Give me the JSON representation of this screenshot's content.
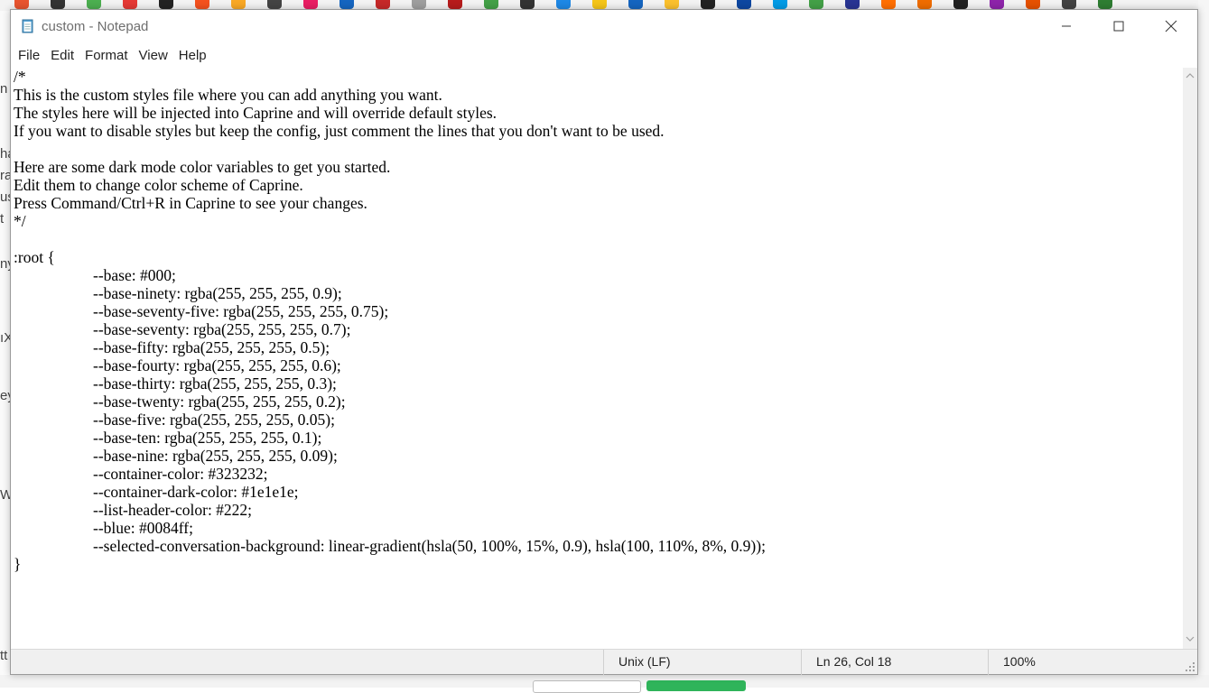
{
  "window": {
    "title": "custom - Notepad"
  },
  "menu": [
    "File",
    "Edit",
    "Format",
    "View",
    "Help"
  ],
  "editor_lines": [
    {
      "text": "/*",
      "indent": false
    },
    {
      "text": "This is the custom styles file where you can add anything you want.",
      "indent": false
    },
    {
      "text": "The styles here will be injected into Caprine and will override default styles.",
      "indent": false
    },
    {
      "text": "If you want to disable styles but keep the config, just comment the lines that you don't want to be used.",
      "indent": false
    },
    {
      "text": "",
      "indent": false
    },
    {
      "text": "Here are some dark mode color variables to get you started.",
      "indent": false
    },
    {
      "text": "Edit them to change color scheme of Caprine.",
      "indent": false
    },
    {
      "text": "Press Command/Ctrl+R in Caprine to see your changes.",
      "indent": false
    },
    {
      "text": "*/",
      "indent": false
    },
    {
      "text": "",
      "indent": false
    },
    {
      "text": ":root {",
      "indent": false
    },
    {
      "text": "--base: #000;",
      "indent": true
    },
    {
      "text": "--base-ninety: rgba(255, 255, 255, 0.9);",
      "indent": true
    },
    {
      "text": "--base-seventy-five: rgba(255, 255, 255, 0.75);",
      "indent": true
    },
    {
      "text": "--base-seventy: rgba(255, 255, 255, 0.7);",
      "indent": true
    },
    {
      "text": "--base-fifty: rgba(255, 255, 255, 0.5);",
      "indent": true
    },
    {
      "text": "--base-fourty: rgba(255, 255, 255, 0.6);",
      "indent": true
    },
    {
      "text": "--base-thirty: rgba(255, 255, 255, 0.3);",
      "indent": true
    },
    {
      "text": "--base-twenty: rgba(255, 255, 255, 0.2);",
      "indent": true
    },
    {
      "text": "--base-five: rgba(255, 255, 255, 0.05);",
      "indent": true
    },
    {
      "text": "--base-ten: rgba(255, 255, 255, 0.1);",
      "indent": true
    },
    {
      "text": "--base-nine: rgba(255, 255, 255, 0.09);",
      "indent": true
    },
    {
      "text": "--container-color: #323232;",
      "indent": true
    },
    {
      "text": "--container-dark-color: #1e1e1e;",
      "indent": true
    },
    {
      "text": "--list-header-color: #222;",
      "indent": true
    },
    {
      "text": "--blue: #0084ff;",
      "indent": true
    },
    {
      "text": "--selected-conversation-background: linear-gradient(hsla(50, 100%, 15%, 0.9), hsla(100, 110%, 8%, 0.9));",
      "indent": true
    },
    {
      "text": "}",
      "indent": false
    }
  ],
  "status": {
    "line_ending": "Unix (LF)",
    "cursor": "Ln 26, Col 18",
    "zoom": "100%"
  },
  "background_fragments": [
    "n",
    "ha",
    "ra",
    "us",
    "t",
    "ny",
    "ıX",
    "ey",
    "W",
    "tt"
  ],
  "colors": {
    "title_text": "#6e6e6e",
    "statusbar_bg": "#f0f0f0",
    "scrollbar_bg": "#f0f0f0",
    "taskbar_icon_colors": [
      "#e8542f",
      "#333333",
      "#4caf50",
      "#e53935",
      "#222222",
      "#f4511e",
      "#f9a825",
      "#444444",
      "#e91e63",
      "#1565c0",
      "#c62828",
      "#9e9e9e",
      "#b71c1c",
      "#43a047",
      "#333333",
      "#1e88e5",
      "#f5c518",
      "#1565c0",
      "#fbc02d",
      "#222222",
      "#0d47a1",
      "#039be5",
      "#43a047",
      "#283593",
      "#ff6f00",
      "#ef6c00",
      "#212121",
      "#8e24aa",
      "#e65100",
      "#424242",
      "#2e7d32"
    ]
  }
}
